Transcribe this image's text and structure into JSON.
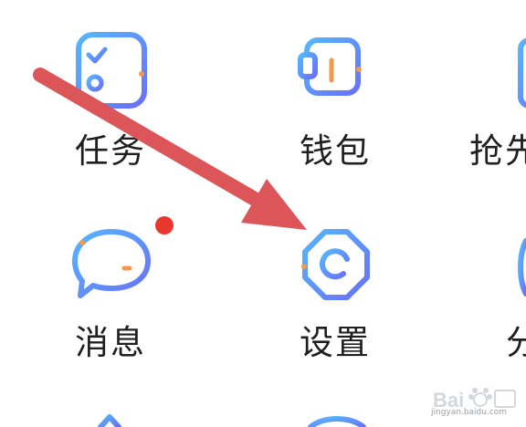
{
  "grid": {
    "items": [
      {
        "label": "任务",
        "icon": "task-list-icon"
      },
      {
        "label": "钱包",
        "icon": "wallet-icon"
      },
      {
        "label": "抢先",
        "icon": "partial-icon"
      },
      {
        "label": "消息",
        "icon": "message-bubble-icon"
      },
      {
        "label": "设置",
        "icon": "settings-gear-icon"
      },
      {
        "label": "分",
        "icon": "partial-icon"
      }
    ],
    "notification_color": "#e8382d"
  },
  "watermark": {
    "line2": "jingyan.baidu.com"
  },
  "colors": {
    "icon_gradient_start": "#5ab0ff",
    "icon_gradient_end": "#6b6ff5",
    "accent_orange": "#f2994a",
    "arrow": "#dc5559"
  }
}
